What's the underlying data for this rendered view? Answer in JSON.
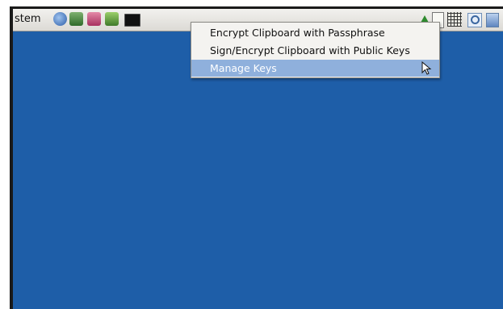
{
  "panel": {
    "menu_label": "stem",
    "launchers": [
      "web-browser-icon",
      "mail-icon",
      "office-icon",
      "network-icon",
      "terminal-icon"
    ],
    "tray": [
      "notification-arrow-icon",
      "clipboard-icon",
      "keyboard-grid-icon",
      "search-icon",
      "applet-icon"
    ]
  },
  "menu": {
    "items": [
      "Encrypt Clipboard with Passphrase",
      "Sign/Encrypt Clipboard with Public Keys",
      "Manage Keys"
    ],
    "selected_index": 2
  },
  "colors": {
    "desktop": "#1e5ea8",
    "panel": "#e8e7e3",
    "menu_highlight": "#8fb0dc"
  }
}
